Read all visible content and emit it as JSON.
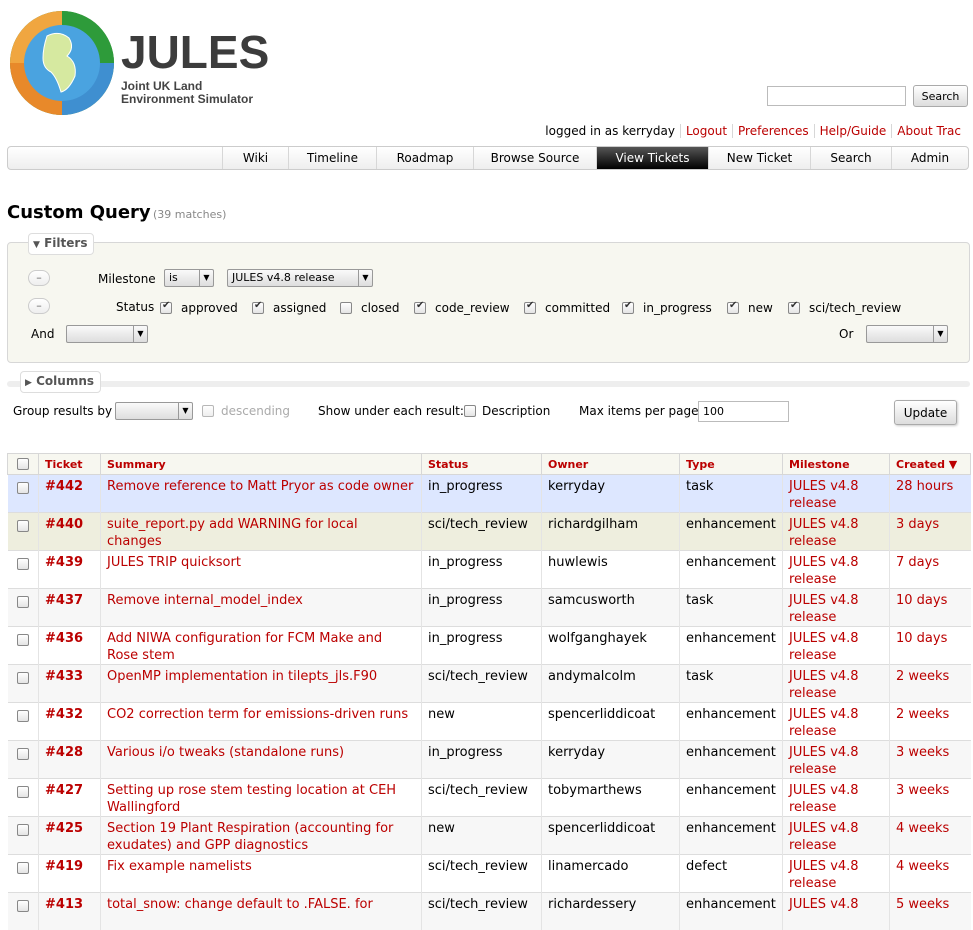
{
  "logo": {
    "title": "JULES",
    "subtitle_line1": "Joint UK Land",
    "subtitle_line2": "Environment Simulator"
  },
  "search": {
    "placeholder": "",
    "button_label": "Search"
  },
  "metanav": {
    "logged_in": "logged in as kerryday",
    "logout": "Logout",
    "preferences": "Preferences",
    "help": "Help/Guide",
    "about": "About Trac"
  },
  "mainnav": [
    "Wiki",
    "Timeline",
    "Roadmap",
    "Browse Source",
    "View Tickets",
    "New Ticket",
    "Search",
    "Admin"
  ],
  "page": {
    "title": "Custom Query",
    "match_count": "(39 matches)"
  },
  "filters": {
    "legend": "Filters",
    "milestone_label": "Milestone",
    "milestone_op": "is",
    "milestone_value": "JULES v4.8 release",
    "status_label": "Status",
    "statuses": [
      {
        "label": "approved",
        "checked": true
      },
      {
        "label": "assigned",
        "checked": true
      },
      {
        "label": "closed",
        "checked": false
      },
      {
        "label": "code_review",
        "checked": true
      },
      {
        "label": "committed",
        "checked": true
      },
      {
        "label": "in_progress",
        "checked": true
      },
      {
        "label": "new",
        "checked": true
      },
      {
        "label": "sci/tech_review",
        "checked": true
      }
    ],
    "and_label": "And",
    "or_label": "Or"
  },
  "columns": {
    "legend": "Columns"
  },
  "options": {
    "group_label": "Group results by",
    "descending_label": "descending",
    "show_label": "Show under each result:",
    "description_label": "Description",
    "max_label": "Max items per page",
    "max_value": "100",
    "update_label": "Update"
  },
  "table": {
    "headers": {
      "ticket": "Ticket",
      "summary": "Summary",
      "status": "Status",
      "owner": "Owner",
      "type": "Type",
      "milestone": "Milestone",
      "created": "Created ▼"
    },
    "rows": [
      {
        "id": "#442",
        "summary": "Remove reference to Matt Pryor as code owner",
        "status": "in_progress",
        "owner": "kerryday",
        "type": "task",
        "milestone": "JULES v4.8 release",
        "created": "28 hours"
      },
      {
        "id": "#440",
        "summary": "suite_report.py add WARNING for local changes",
        "status": "sci/tech_review",
        "owner": "richardgilham",
        "type": "enhancement",
        "milestone": "JULES v4.8 release",
        "created": "3 days"
      },
      {
        "id": "#439",
        "summary": "JULES TRIP quicksort",
        "status": "in_progress",
        "owner": "huwlewis",
        "type": "enhancement",
        "milestone": "JULES v4.8 release",
        "created": "7 days"
      },
      {
        "id": "#437",
        "summary": "Remove internal_model_index",
        "status": "in_progress",
        "owner": "samcusworth",
        "type": "task",
        "milestone": "JULES v4.8 release",
        "created": "10 days"
      },
      {
        "id": "#436",
        "summary": "Add NIWA configuration for FCM Make and Rose stem",
        "status": "in_progress",
        "owner": "wolfganghayek",
        "type": "enhancement",
        "milestone": "JULES v4.8 release",
        "created": "10 days"
      },
      {
        "id": "#433",
        "summary": "OpenMP implementation in tilepts_jls.F90",
        "status": "sci/tech_review",
        "owner": "andymalcolm",
        "type": "task",
        "milestone": "JULES v4.8 release",
        "created": "2 weeks"
      },
      {
        "id": "#432",
        "summary": "CO2 correction term for emissions-driven runs",
        "status": "new",
        "owner": "spencerliddicoat",
        "type": "enhancement",
        "milestone": "JULES v4.8 release",
        "created": "2 weeks"
      },
      {
        "id": "#428",
        "summary": "Various i/o tweaks (standalone runs)",
        "status": "in_progress",
        "owner": "kerryday",
        "type": "enhancement",
        "milestone": "JULES v4.8 release",
        "created": "3 weeks"
      },
      {
        "id": "#427",
        "summary": "Setting up rose stem testing location at CEH Wallingford",
        "status": "sci/tech_review",
        "owner": "tobymarthews",
        "type": "enhancement",
        "milestone": "JULES v4.8 release",
        "created": "3 weeks"
      },
      {
        "id": "#425",
        "summary": "Section 19 Plant Respiration (accounting for exudates) and GPP diagnostics",
        "status": "new",
        "owner": "spencerliddicoat",
        "type": "enhancement",
        "milestone": "JULES v4.8 release",
        "created": "4 weeks"
      },
      {
        "id": "#419",
        "summary": "Fix example namelists",
        "status": "sci/tech_review",
        "owner": "linamercado",
        "type": "defect",
        "milestone": "JULES v4.8 release",
        "created": "4 weeks"
      },
      {
        "id": "#413",
        "summary": "total_snow: change default to .FALSE. for",
        "status": "sci/tech_review",
        "owner": "richardessery",
        "type": "enhancement",
        "milestone": "JULES v4.8",
        "created": "5 weeks"
      }
    ]
  }
}
